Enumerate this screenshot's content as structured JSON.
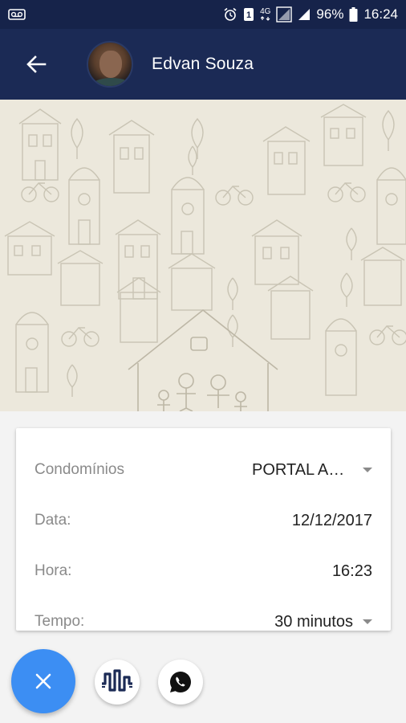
{
  "status_bar": {
    "battery": "96%",
    "time": "16:24",
    "network_type": "4G",
    "icons": [
      "voicemail-icon",
      "alarm-icon",
      "notification-icon",
      "4g-icon",
      "signal-icon",
      "signal-bars-icon",
      "battery-icon"
    ]
  },
  "app_bar": {
    "contact_name": "Edvan Souza",
    "back_icon": "arrow-left-icon",
    "background_color": "#1b2a55"
  },
  "form": {
    "rows": [
      {
        "label": "Condomínios",
        "value": "PORTAL AMBIENTE",
        "dropdown": true
      },
      {
        "label": "Data:",
        "value": "12/12/2017",
        "dropdown": false
      },
      {
        "label": "Hora:",
        "value": "16:23",
        "dropdown": false
      },
      {
        "label": "Tempo:",
        "value": "30 minutos",
        "dropdown": true
      }
    ]
  },
  "actions": {
    "fab_icon": "close-icon",
    "fab_color": "#3c8ef3",
    "buttons": [
      "building-logo-icon",
      "whatsapp-icon"
    ]
  }
}
